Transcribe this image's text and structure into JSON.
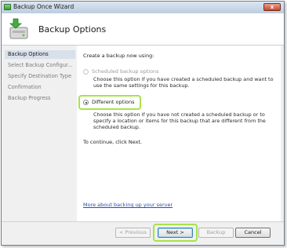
{
  "window": {
    "title": "Backup Once Wizard",
    "close_glyph": "x"
  },
  "header": {
    "title": "Backup Options",
    "icon": "backup-wizard-icon"
  },
  "sidebar": {
    "items": [
      {
        "label": "Backup Options",
        "active": true
      },
      {
        "label": "Select Backup Configur..."
      },
      {
        "label": "Specify Destination Type"
      },
      {
        "label": "Confirmation"
      },
      {
        "label": "Backup Progress"
      }
    ]
  },
  "content": {
    "intro": "Create a backup now using:",
    "option_scheduled": {
      "label": "Scheduled backup options",
      "description": "Choose this option if you have created a scheduled backup and want to use the same settings for this backup.",
      "enabled": false
    },
    "option_different": {
      "label": "Different options",
      "description": "Choose this option if you have not created a scheduled backup or to specify a location or items for this backup that are different from the scheduled backup.",
      "selected": true
    },
    "continue_text": "To continue, click Next.",
    "help_link": "More about backing up your server"
  },
  "footer": {
    "previous": "< Previous",
    "next": "Next >",
    "backup": "Backup",
    "cancel": "Cancel"
  },
  "colors": {
    "highlight": "#a7e34a",
    "link": "#2b4db5",
    "selection": "#d8e0ea"
  }
}
